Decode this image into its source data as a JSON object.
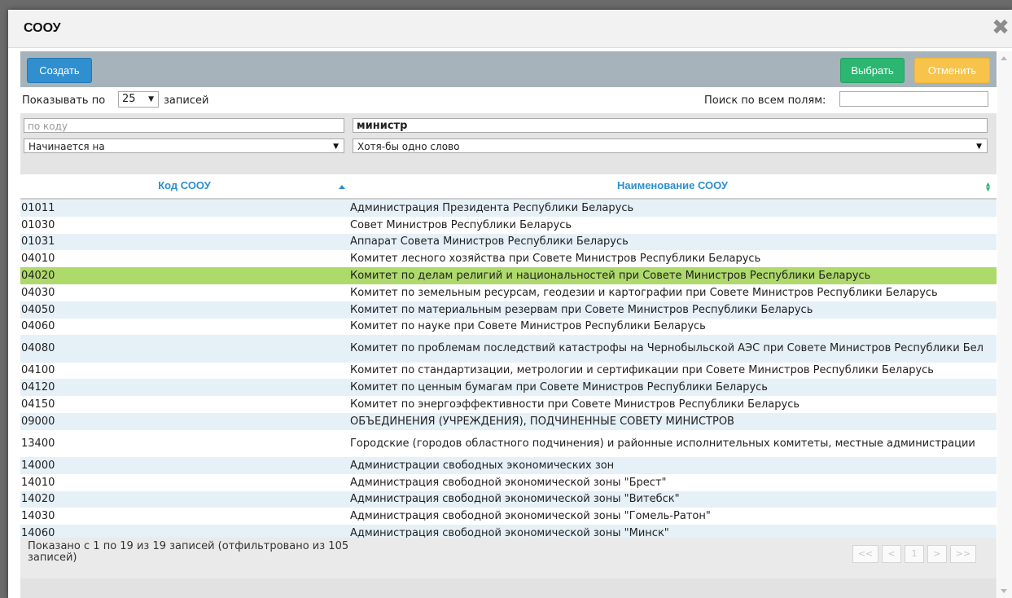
{
  "dialog": {
    "title": "СООУ"
  },
  "toolbar": {
    "create_label": "Создать",
    "select_label": "Выбрать",
    "cancel_label": "Отменить"
  },
  "length": {
    "label_before": "Показывать по",
    "value": "25",
    "label_after": "записей"
  },
  "search": {
    "label": "Поиск по всем полям:",
    "value": ""
  },
  "filters": {
    "code_placeholder": "по коду",
    "name_value": "министр",
    "code_mode": "Начинается на",
    "name_mode": "Хотя-бы одно слово"
  },
  "table": {
    "columns": [
      "Код СООУ",
      "Наименование СООУ"
    ],
    "rows": [
      {
        "code": "01011",
        "name": "Администрация Президента Республики Беларусь"
      },
      {
        "code": "01030",
        "name": "Совет Министров Республики Беларусь"
      },
      {
        "code": "01031",
        "name": "Аппарат Совета Министров Республики Беларусь"
      },
      {
        "code": "04010",
        "name": "Комитет лесного хозяйства при Совете Министров Республики Беларусь"
      },
      {
        "code": "04020",
        "name": "Комитет по делам религий и национальностей при Совете Министров Республики Беларусь",
        "selected": true
      },
      {
        "code": "04030",
        "name": "Комитет по земельным ресурсам, геодезии и картографии при Совете Министров Республики Беларусь"
      },
      {
        "code": "04050",
        "name": "Комитет по материальным резервам при Совете Министров Республики Беларусь"
      },
      {
        "code": "04060",
        "name": "Комитет по науке при Совете Министров Республики Беларусь"
      },
      {
        "code": "04080",
        "name": "Комитет по проблемам последствий катастрофы на Чернобыльской АЭС при Совете Министров Республики Бел",
        "tall": true
      },
      {
        "code": "04100",
        "name": "Комитет по стандартизации, метрологии и сертификации при Совете Министров Республики Беларусь"
      },
      {
        "code": "04120",
        "name": "Комитет по ценным бумагам при Совете Министров Республики Беларусь"
      },
      {
        "code": "04150",
        "name": "Комитет по энергоэффективности при Совете Министров Республики Беларусь"
      },
      {
        "code": "09000",
        "name": "ОБЪЕДИНЕНИЯ (УЧРЕЖДЕНИЯ), ПОДЧИНЕННЫЕ СОВЕТУ МИНИСТРОВ"
      },
      {
        "code": "13400",
        "name": "Городские (городов областного подчинения) и районные исполнительных комитеты, местные администрации",
        "tall": true
      },
      {
        "code": "14000",
        "name": "Администрации свободных экономических зон"
      },
      {
        "code": "14010",
        "name": "Администрация свободной экономической зоны \"Брест\""
      },
      {
        "code": "14020",
        "name": "Администрация свободной экономической зоны \"Витебск\""
      },
      {
        "code": "14030",
        "name": "Администрация свободной экономической зоны \"Гомель-Ратон\""
      },
      {
        "code": "14060",
        "name": "Администрация свободной экономической зоны \"Минск\""
      }
    ]
  },
  "footer": {
    "info": "Показано с 1 по 19 из 19 записей (отфильтровано из 105 записей)"
  },
  "pager": {
    "first": "<<",
    "prev": "<",
    "page": "1",
    "next": ">",
    "last": ">>"
  },
  "colors": {
    "selected_row": "#aed96b",
    "odd_row": "#e6f0f7",
    "header_text": "#2a8fd0",
    "create": "#2f8fcf",
    "select": "#2db572",
    "cancel": "#f7c34a"
  }
}
